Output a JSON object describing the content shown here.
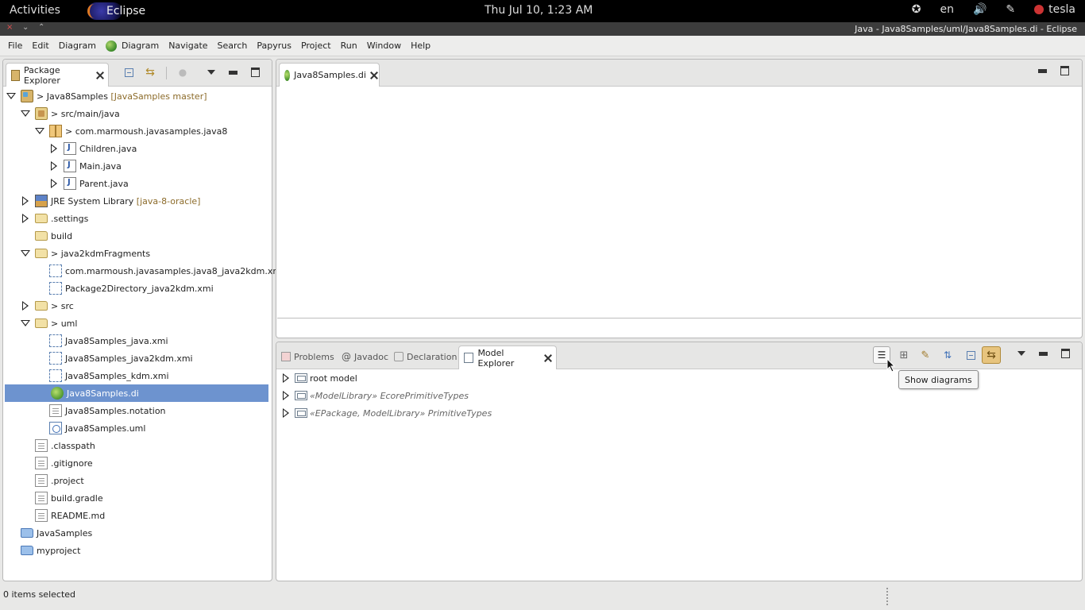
{
  "topbar": {
    "activities": "Activities",
    "app_name": "Eclipse",
    "clock": "Thu Jul 10,  1:23 AM",
    "accessibility_icon": "accessibility-icon",
    "language": "en",
    "volume_icon": "volume-icon",
    "pen_icon": "pen-icon",
    "user": "tesla"
  },
  "window": {
    "title": "Java - Java8Samples/uml/Java8Samples.di - Eclipse",
    "controls": [
      "×",
      "⌄",
      "⌃"
    ]
  },
  "menu": {
    "items": [
      "File",
      "Edit",
      "Diagram",
      "Diagram",
      "Navigate",
      "Search",
      "Papyrus",
      "Project",
      "Run",
      "Window",
      "Help"
    ]
  },
  "package_explorer": {
    "tab_label": "Package Explorer",
    "tree": [
      {
        "label": "> Java8Samples",
        "deco": " [JavaSamples master]",
        "icon": "project-icon",
        "twist": "open"
      },
      {
        "label": "> src/main/java",
        "deco": "",
        "icon": "source-folder-icon",
        "twist": "open"
      },
      {
        "label": "> com.marmoush.javasamples.java8",
        "deco": "",
        "icon": "package-icon",
        "twist": "open"
      },
      {
        "label": "Children.java",
        "deco": "",
        "icon": "java-file-icon",
        "twist": "closed"
      },
      {
        "label": "Main.java",
        "deco": "",
        "icon": "java-file-icon",
        "twist": "closed"
      },
      {
        "label": "Parent.java",
        "deco": "",
        "icon": "java-file-icon",
        "twist": "closed"
      },
      {
        "label": "JRE System Library",
        "deco": " [java-8-oracle]",
        "icon": "library-icon",
        "twist": "closed"
      },
      {
        "label": ".settings",
        "deco": "",
        "icon": "folder-icon",
        "twist": "closed"
      },
      {
        "label": "build",
        "deco": "",
        "icon": "folder-icon",
        "twist": "none"
      },
      {
        "label": "> java2kdmFragments",
        "deco": "",
        "icon": "folder-icon",
        "twist": "open"
      },
      {
        "label": "com.marmoush.javasamples.java8_java2kdm.xmi",
        "deco": "",
        "icon": "xmi-file-icon",
        "twist": "none"
      },
      {
        "label": "Package2Directory_java2kdm.xmi",
        "deco": "",
        "icon": "xmi-file-icon",
        "twist": "none"
      },
      {
        "label": "> src",
        "deco": "",
        "icon": "folder-icon",
        "twist": "closed"
      },
      {
        "label": "> uml",
        "deco": "",
        "icon": "folder-icon",
        "twist": "open"
      },
      {
        "label": "Java8Samples_java.xmi",
        "deco": "",
        "icon": "xmi-file-icon",
        "twist": "none"
      },
      {
        "label": "Java8Samples_java2kdm.xmi",
        "deco": "",
        "icon": "xmi-file-icon",
        "twist": "none"
      },
      {
        "label": "Java8Samples_kdm.xmi",
        "deco": "",
        "icon": "xmi-file-icon",
        "twist": "none"
      },
      {
        "label": "Java8Samples.di",
        "deco": "",
        "icon": "papyrus-di-icon",
        "twist": "none",
        "selected": true
      },
      {
        "label": "Java8Samples.notation",
        "deco": "",
        "icon": "file-icon",
        "twist": "none"
      },
      {
        "label": "Java8Samples.uml",
        "deco": "",
        "icon": "uml-file-icon",
        "twist": "none"
      },
      {
        "label": ".classpath",
        "deco": "",
        "icon": "file-icon",
        "twist": "none"
      },
      {
        "label": ".gitignore",
        "deco": "",
        "icon": "file-icon",
        "twist": "none"
      },
      {
        "label": ".project",
        "deco": "",
        "icon": "file-icon",
        "twist": "none"
      },
      {
        "label": "build.gradle",
        "deco": "",
        "icon": "file-icon",
        "twist": "none"
      },
      {
        "label": "README.md",
        "deco": "",
        "icon": "file-icon",
        "twist": "none"
      },
      {
        "label": "JavaSamples",
        "deco": "",
        "icon": "closed-project-icon",
        "twist": "none"
      },
      {
        "label": "myproject",
        "deco": "",
        "icon": "closed-project-icon",
        "twist": "none"
      }
    ]
  },
  "editor": {
    "tab_label": "Java8Samples.di"
  },
  "bottom_panel": {
    "tabs": [
      "Problems",
      "Javadoc",
      "Declaration",
      "Model Explorer"
    ],
    "active_tab": "Model Explorer",
    "tree": [
      {
        "label": "root model",
        "italic": false
      },
      {
        "label": "«ModelLibrary» EcorePrimitiveTypes",
        "italic": true
      },
      {
        "label": "«EPackage, ModelLibrary» PrimitiveTypes",
        "italic": true
      }
    ],
    "tooltip": "Show diagrams"
  },
  "status": {
    "text": "0 items selected"
  },
  "colors": {
    "selection": "#6d93cf",
    "decoration": "#8c6b2a"
  }
}
